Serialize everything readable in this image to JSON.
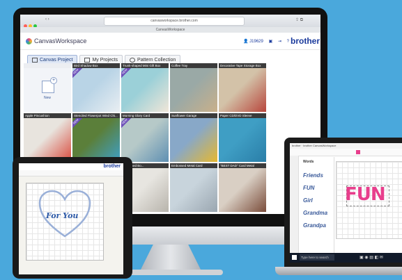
{
  "browser": {
    "url": "canvasworkspace.brother.com",
    "tab_title": "CanvasWorkspace"
  },
  "app": {
    "logo_text": "CanvasWorkspace",
    "user_id": "J19629",
    "brand": "brother"
  },
  "tabs": [
    {
      "label": "Canvas Project"
    },
    {
      "label": "My Projects"
    },
    {
      "label": "Pattern Collection"
    }
  ],
  "new_tile": {
    "label": "New"
  },
  "projects": [
    {
      "title": "Bird Shadow Box",
      "new": true,
      "c1": "#b9d4e6",
      "c2": "#e9eef2"
    },
    {
      "title": "Trunk-shaped Mini Gift Box",
      "new": true,
      "c1": "#9bd0d8",
      "c2": "#f0e6d8"
    },
    {
      "title": "Coffee Tray",
      "new": false,
      "c1": "#9aa9a6",
      "c2": "#c9b08a"
    },
    {
      "title": "Decorative Tape Storage Box",
      "new": false,
      "c1": "#d3c2a8",
      "c2": "#b8463c"
    },
    {
      "title": "Apple Pincushion",
      "new": false,
      "c1": "#e8e4de",
      "c2": "#d94a3c"
    },
    {
      "title": "Stenciled Flowerpot Wind Chi...",
      "new": true,
      "c1": "#5b7f3a",
      "c2": "#3ea0c8"
    },
    {
      "title": "Morning Glory Card",
      "new": true,
      "c1": "#b6c9c8",
      "c2": "#5e8fb2"
    },
    {
      "title": "Sunflower Garage",
      "new": false,
      "c1": "#88a8c8",
      "c2": "#e6b830"
    },
    {
      "title": "Paper CD/DVD Sleeve",
      "new": false,
      "c1": "#3f9ec4",
      "c2": "#2a7ea8"
    },
    {
      "title": "CD/DVD Sleeve Holder",
      "new": false,
      "c1": "#d6c19c",
      "c2": "#4aa0bd"
    },
    {
      "title": "Boy Festival Ornament",
      "new": false,
      "c1": "#c9c4ba",
      "c2": "#4f6a9c"
    },
    {
      "title": "...-shaped Bo...",
      "new": false,
      "c1": "#e7e5e0",
      "c2": "#b8b4ac"
    },
    {
      "title": "Embossed Metal Card",
      "new": false,
      "c1": "#c8d4dc",
      "c2": "#9aa6b0"
    },
    {
      "title": "\"BEST DAD\" Card Metal",
      "new": false,
      "c1": "#d9cfc4",
      "c2": "#7a4c3a"
    },
    {
      "title": "Father's D...",
      "new": false,
      "c1": "#c7c9ce",
      "c2": "#8a8f98"
    }
  ],
  "tablet": {
    "brand": "brother",
    "canvas_text": "For You"
  },
  "laptop": {
    "title_bar": "brother · brother CanvasWorkspace",
    "fonts": [
      "Words",
      "Friends",
      "FUN",
      "Girl",
      "Grandma",
      "Grandpa"
    ],
    "canvas_text": "FUN",
    "search": "Type here to search"
  },
  "colors": {
    "background": "#4aa8dc",
    "brand_blue": "#1a3a9c",
    "new_ribbon": "#6c4fb8",
    "fun_pink": "#e83e8c"
  }
}
